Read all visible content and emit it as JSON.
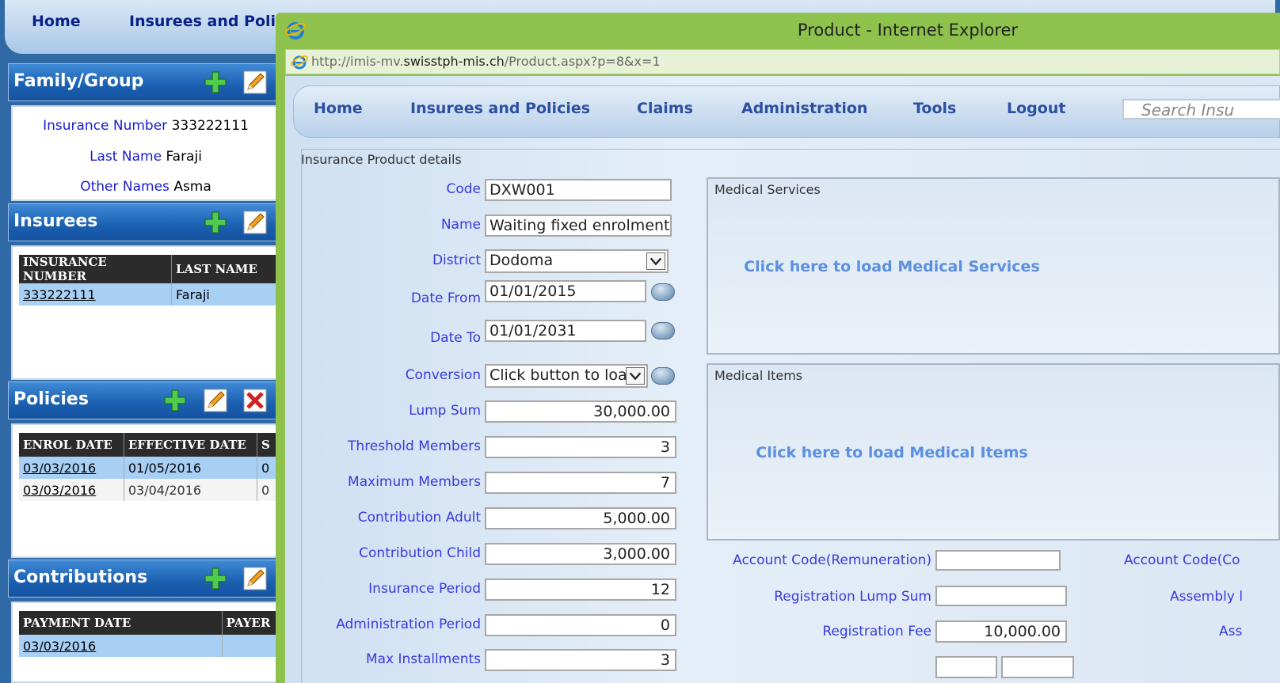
{
  "bg_app": {
    "nav": [
      "Home",
      "Insurees and Poli"
    ],
    "family_panel": {
      "title": "Family/Group",
      "insurance_number_label": "Insurance Number",
      "insurance_number": "333222111",
      "last_name_label": "Last Name",
      "last_name": "Faraji",
      "other_names_label": "Other Names",
      "other_names": "Asma"
    },
    "insurees_panel": {
      "title": "Insurees",
      "columns": [
        "INSURANCE NUMBER",
        "LAST NAME"
      ],
      "rows": [
        [
          "333222111",
          "Faraji"
        ]
      ]
    },
    "policies_panel": {
      "title": "Policies",
      "columns": [
        "ENROL DATE",
        "EFFECTIVE DATE",
        "S"
      ],
      "rows": [
        [
          "03/03/2016",
          "01/05/2016",
          "0"
        ],
        [
          "03/03/2016",
          "03/04/2016",
          "0"
        ]
      ]
    },
    "contributions_panel": {
      "title": "Contributions",
      "columns": [
        "PAYMENT DATE",
        "PAYER"
      ],
      "rows": [
        [
          "03/03/2016",
          ""
        ]
      ]
    }
  },
  "ie_window": {
    "title": "Product - Internet Explorer",
    "url_prefix": "http://imis-mv.",
    "url_domain": "swisstph-mis.ch",
    "url_path": "/Product.aspx?p=8&x=1"
  },
  "inner_nav": {
    "items": [
      "Home",
      "Insurees and Policies",
      "Claims",
      "Administration",
      "Tools",
      "Logout"
    ],
    "search_placeholder": "Search Insu"
  },
  "product": {
    "legend": "Insurance Product details",
    "code_label": "Code",
    "code": "DXW001",
    "name_label": "Name",
    "name": "Waiting fixed enrolment D",
    "district_label": "District",
    "district": "Dodoma",
    "date_from_label": "Date From",
    "date_from": "01/01/2015",
    "date_to_label": "Date To",
    "date_to": "01/01/2031",
    "conversion_label": "Conversion",
    "conversion": "Click button to load",
    "lump_sum_label": "Lump Sum",
    "lump_sum": "30,000.00",
    "threshold_label": "Threshold Members",
    "threshold": "3",
    "max_members_label": "Maximum Members",
    "max_members": "7",
    "contrib_adult_label": "Contribution Adult",
    "contrib_adult": "5,000.00",
    "contrib_child_label": "Contribution Child",
    "contrib_child": "3,000.00",
    "ins_period_label": "Insurance Period",
    "ins_period": "12",
    "admin_period_label": "Administration Period",
    "admin_period": "0",
    "max_install_label": "Max Installments",
    "max_install": "3",
    "medical_services_caption": "Medical Services",
    "medical_services_load": "Click here to load Medical Services",
    "medical_items_caption": "Medical Items",
    "medical_items_load": "Click here to load Medical Items",
    "acc_remun_label": "Account Code(Remuneration)",
    "acc_remun": "",
    "acc_co_label": "Account Code(Co",
    "reg_lump_label": "Registration Lump Sum",
    "reg_lump": "",
    "assembly_label": "Assembly l",
    "reg_fee_label": "Registration Fee",
    "reg_fee": "10,000.00",
    "ass_label": "Ass"
  }
}
